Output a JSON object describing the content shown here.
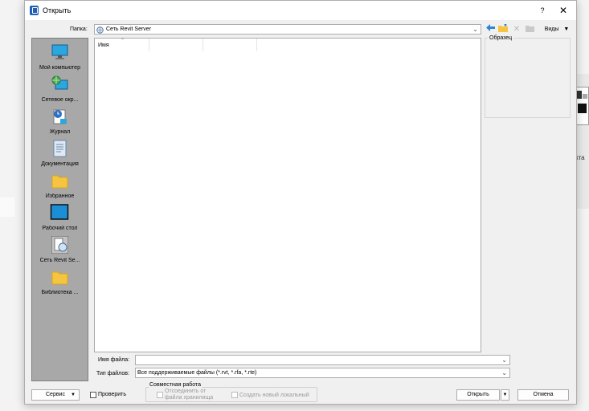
{
  "window": {
    "title": "Открыть",
    "help_glyph": "?",
    "close_glyph": "✕"
  },
  "folder": {
    "label": "Папка:",
    "value": "Сеть Revit Server"
  },
  "toolbar": {
    "views_label": "Виды"
  },
  "places": [
    {
      "label": "Мой компьютер",
      "icon": "computer-icon"
    },
    {
      "label": "Сетевое окр...",
      "icon": "network-icon"
    },
    {
      "label": "Журнал",
      "icon": "history-icon"
    },
    {
      "label": "Документация",
      "icon": "documents-icon"
    },
    {
      "label": "Избранное",
      "icon": "favorites-folder-icon"
    },
    {
      "label": "Рабочий стол",
      "icon": "desktop-icon"
    },
    {
      "label": "Сеть Revit Se...",
      "icon": "revit-server-icon"
    },
    {
      "label": "Библиотека ...",
      "icon": "library-folder-icon"
    }
  ],
  "file_list": {
    "columns": [
      "Имя",
      "",
      "",
      ""
    ]
  },
  "preview": {
    "label": "Образец"
  },
  "file_name": {
    "label": "Имя файла:",
    "value": ""
  },
  "file_type": {
    "label": "Тип файлов:",
    "value": "Все поддерживаемые файлы (*.rvt, *.rfa, *.rte)"
  },
  "bottom": {
    "service_label": "Сервис",
    "verify_label": "Проверить",
    "collab_group_label": "Совместная работа",
    "detach_label": "Отсоединить от файла хранилища",
    "create_local_label": "Создать новый локальный",
    "open_label": "Открыть",
    "cancel_label": "Отмена"
  },
  "background": {
    "partial_text": "кта"
  },
  "colors": {
    "accent": "#1f5fb5",
    "places_bg": "#a8a8a8",
    "folder_yellow": "#f5c542"
  }
}
